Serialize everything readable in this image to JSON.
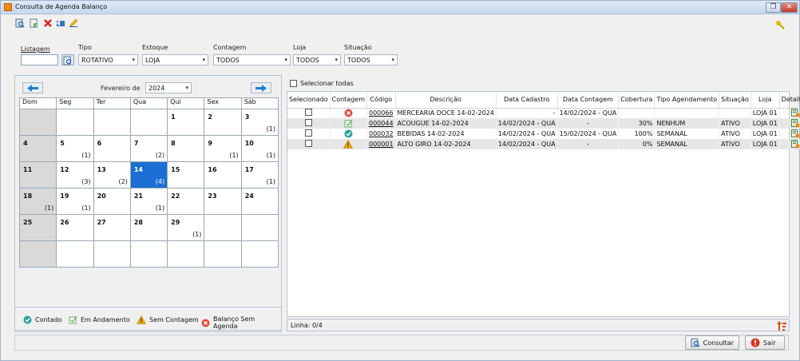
{
  "window": {
    "title": "Consulta de Agenda Balanço"
  },
  "filters": {
    "listagem": {
      "label": "Listagem",
      "value": ""
    },
    "tipo": {
      "label": "Tipo",
      "value": "ROTATIVO"
    },
    "estoque": {
      "label": "Estoque",
      "value": "LOJA"
    },
    "contagem": {
      "label": "Contagem",
      "value": "TODOS"
    },
    "loja": {
      "label": "Loja",
      "value": "TODOS"
    },
    "situacao": {
      "label": "Situação",
      "value": "TODOS"
    }
  },
  "calendar": {
    "month": "Fevereiro de",
    "year": "2024",
    "weekdays": [
      "Dom",
      "Seg",
      "Ter",
      "Qua",
      "Qui",
      "Sex",
      "Sáb"
    ],
    "selected_day": "14",
    "weeks": [
      [
        {
          "d": "",
          "c": ""
        },
        {
          "d": "",
          "c": ""
        },
        {
          "d": "",
          "c": ""
        },
        {
          "d": "",
          "c": ""
        },
        {
          "d": "1",
          "c": ""
        },
        {
          "d": "2",
          "c": ""
        },
        {
          "d": "3",
          "c": "(1)"
        }
      ],
      [
        {
          "d": "4",
          "c": ""
        },
        {
          "d": "5",
          "c": "(1)"
        },
        {
          "d": "6",
          "c": ""
        },
        {
          "d": "7",
          "c": "(2)"
        },
        {
          "d": "8",
          "c": ""
        },
        {
          "d": "9",
          "c": "(1)"
        },
        {
          "d": "10",
          "c": "(1)"
        }
      ],
      [
        {
          "d": "11",
          "c": ""
        },
        {
          "d": "12",
          "c": "(3)"
        },
        {
          "d": "13",
          "c": "(2)"
        },
        {
          "d": "14",
          "c": "(4)"
        },
        {
          "d": "15",
          "c": ""
        },
        {
          "d": "16",
          "c": ""
        },
        {
          "d": "17",
          "c": "(1)"
        }
      ],
      [
        {
          "d": "18",
          "c": "(1)"
        },
        {
          "d": "19",
          "c": "(1)"
        },
        {
          "d": "20",
          "c": ""
        },
        {
          "d": "21",
          "c": "(1)"
        },
        {
          "d": "22",
          "c": ""
        },
        {
          "d": "23",
          "c": ""
        },
        {
          "d": "24",
          "c": ""
        }
      ],
      [
        {
          "d": "25",
          "c": ""
        },
        {
          "d": "26",
          "c": ""
        },
        {
          "d": "27",
          "c": ""
        },
        {
          "d": "28",
          "c": ""
        },
        {
          "d": "29",
          "c": "(1)"
        },
        {
          "d": "",
          "c": ""
        },
        {
          "d": "",
          "c": ""
        }
      ],
      [
        {
          "d": "",
          "c": ""
        },
        {
          "d": "",
          "c": ""
        },
        {
          "d": "",
          "c": ""
        },
        {
          "d": "",
          "c": ""
        },
        {
          "d": "",
          "c": ""
        },
        {
          "d": "",
          "c": ""
        },
        {
          "d": "",
          "c": ""
        }
      ]
    ]
  },
  "legend": {
    "contado": "Contado",
    "andamento": "Em Andamento",
    "sem_contagem": "Sem Contagem",
    "balanco_sem_agenda": "Balanço Sem Agenda"
  },
  "select_all_label": "Selecionar todas",
  "grid": {
    "columns": [
      "Selecionado",
      "Contagem",
      "Código",
      "Descrição",
      "Data Cadastro",
      "Data Contagem",
      "Cobertura",
      "Tipo Agendamento",
      "Situação",
      "Loja",
      "Detalhes"
    ],
    "rows": [
      {
        "status": "balanco-sem-agenda",
        "codigo": "000066",
        "descricao": "MERCEARIA DOCE 14-02-2024",
        "data_cadastro": "-",
        "data_contagem": "14/02/2024 - QUA",
        "cobertura": "",
        "tipo": "",
        "situacao": "",
        "loja": "LOJA 01"
      },
      {
        "status": "em-andamento",
        "codigo": "000044",
        "descricao": "ACOUGUE 14-02-2024",
        "data_cadastro": "14/02/2024 - QUA",
        "data_contagem": "-",
        "cobertura": "30%",
        "tipo": "NENHUM",
        "situacao": "ATIVO",
        "loja": "LOJA 01"
      },
      {
        "status": "contado",
        "codigo": "000032",
        "descricao": "BEBIDAS 14-02-2024",
        "data_cadastro": "14/02/2024 - QUA",
        "data_contagem": "15/02/2024 - QUA",
        "cobertura": "100%",
        "tipo": "SEMANAL",
        "situacao": "ATIVO",
        "loja": "LOJA 01"
      },
      {
        "status": "sem-contagem",
        "codigo": "000001",
        "descricao": "ALTO GIRO 14-02-2024",
        "data_cadastro": "14/02/2024 - QUA",
        "data_contagem": "-",
        "cobertura": "0%",
        "tipo": "SEMANAL",
        "situacao": "ATIVO",
        "loja": "LOJA 01"
      }
    ]
  },
  "status_line": "Linha: 0/4",
  "buttons": {
    "consultar": "Consultar",
    "sair": "Sair"
  },
  "colors": {
    "selected_day": "#1b6fd4",
    "contado": "#2aa198",
    "sem_contagem": "#f2a900",
    "balanco": "#e04b3a",
    "andamento": "#5cb85c"
  }
}
